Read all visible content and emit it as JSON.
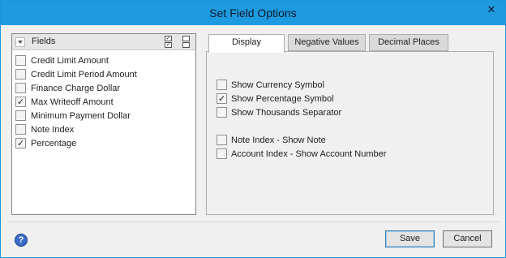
{
  "window": {
    "title": "Set Field Options",
    "close_glyph": "✕"
  },
  "fields": {
    "header_label": "Fields",
    "items": [
      {
        "label": "Credit Limit Amount",
        "checked": false
      },
      {
        "label": "Credit Limit Period Amount",
        "checked": false
      },
      {
        "label": "Finance Charge Dollar",
        "checked": false
      },
      {
        "label": "Max Writeoff Amount",
        "checked": true
      },
      {
        "label": "Minimum Payment Dollar",
        "checked": false
      },
      {
        "label": "Note Index",
        "checked": false
      },
      {
        "label": "Percentage",
        "checked": true
      }
    ]
  },
  "tabs": [
    {
      "label": "Display",
      "active": true
    },
    {
      "label": "Negative Values",
      "active": false
    },
    {
      "label": "Decimal Places",
      "active": false
    }
  ],
  "display_options": [
    {
      "label": "Show Currency Symbol",
      "checked": false
    },
    {
      "label": "Show Percentage Symbol",
      "checked": true
    },
    {
      "label": "Show Thousands Separator",
      "checked": false
    },
    {
      "label": "Note Index - Show Note",
      "checked": false
    },
    {
      "label": "Account Index - Show Account Number",
      "checked": false
    }
  ],
  "buttons": {
    "save": "Save",
    "cancel": "Cancel",
    "help_glyph": "?"
  },
  "icons": {
    "help": "help-icon",
    "header_checks": "check-all-icon"
  },
  "colors": {
    "title_bar": "#1e9be0",
    "dialog_bg": "#f0f0f0"
  }
}
